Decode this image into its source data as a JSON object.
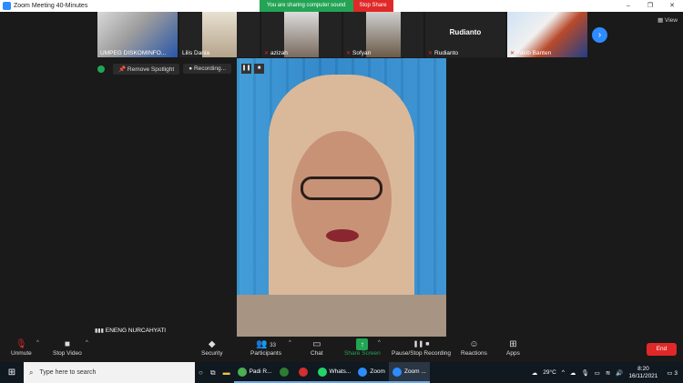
{
  "window": {
    "title": "Zoom Meeting 40-Minutes",
    "controls": [
      "–",
      "❐",
      "✕"
    ]
  },
  "share": {
    "message": "You are sharing computer sound",
    "stop_label": "Stop Share"
  },
  "participants": [
    {
      "name": "UMPEG DISKOMINFO...",
      "muted": false,
      "has_video": true
    },
    {
      "name": "Lilis Dania",
      "muted": false,
      "has_video": true
    },
    {
      "name": "azizah",
      "muted": true,
      "has_video": true
    },
    {
      "name": "Sofyan",
      "muted": true,
      "has_video": true
    },
    {
      "name": "Rudianto",
      "muted": true,
      "has_video": false,
      "big_name": "Rudianto"
    },
    {
      "name": "Yakib Banten",
      "muted": true,
      "has_video": true
    }
  ],
  "view_label": "View",
  "spotlight": {
    "remove_label": "Remove Spotlight",
    "recording_label": "Recording..."
  },
  "speaker": {
    "name": "ENENG NURCAHYATI"
  },
  "toolbar": {
    "unmute": "Unmute",
    "stop_video": "Stop Video",
    "security": "Security",
    "participants": "Participants",
    "participants_count": "33",
    "chat": "Chat",
    "share_screen": "Share Screen",
    "pause_recording": "Pause/Stop Recording",
    "reactions": "Reactions",
    "apps": "Apps",
    "end": "End"
  },
  "taskbar": {
    "search_placeholder": "Type here to search",
    "apps": [
      {
        "label": "Padi R...",
        "color": "#4caf50"
      },
      {
        "label": "",
        "color": "#2e7d32"
      },
      {
        "label": "",
        "color": "#d32f2f"
      },
      {
        "label": "Whats...",
        "color": "#25d366"
      },
      {
        "label": "Zoom",
        "color": "#2d8cff"
      },
      {
        "label": "Zoom ...",
        "color": "#2d8cff"
      }
    ],
    "weather": "29°C",
    "time": "8:20",
    "date": "16/11/2021",
    "notification_count": "3"
  },
  "colors": {
    "accent": "#2d8cff",
    "share_green": "#23a455",
    "danger": "#e02828"
  }
}
